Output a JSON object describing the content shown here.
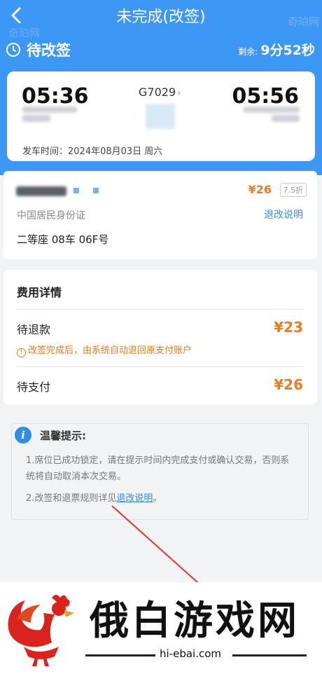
{
  "header": {
    "title": "未完成(改签)",
    "status": "待改签",
    "remaining_prefix": "剩余:",
    "remaining_time": "9分52秒",
    "corner_watermark": "奇珀网"
  },
  "trip": {
    "departure_time": "05:36",
    "arrival_time": "05:56",
    "train_number": "G7029",
    "departure_date": "发车时间：2024年08月03日 周六"
  },
  "passenger": {
    "price": "¥26",
    "discount": "7.5折",
    "id_type": "中国居民身份证",
    "rule_link": "退改说明",
    "seat": "二等座 08车 06F号"
  },
  "fees": {
    "title": "费用详情",
    "refund_label": "待退款",
    "refund_amount": "¥23",
    "refund_note": "改签完成后，由系统自动退回原支付账户",
    "pay_label": "待支付",
    "pay_amount": "¥26"
  },
  "tips": {
    "title": "温馨提示:",
    "tip1": "1.席位已成功锁定，请在提示时间内完成支付或确认交易，否则系统将自动取消本次交易。",
    "tip2_prefix": "2.改签和退票规则详见",
    "tip2_link": "退改说明",
    "tip2_suffix": "。"
  },
  "watermark": {
    "brand": "俄白游戏网",
    "url": "hi-ebai.com"
  },
  "colors": {
    "primary": "#3d97f4",
    "accent_orange": "#f27a1a",
    "link_blue": "#3b8fe6"
  }
}
